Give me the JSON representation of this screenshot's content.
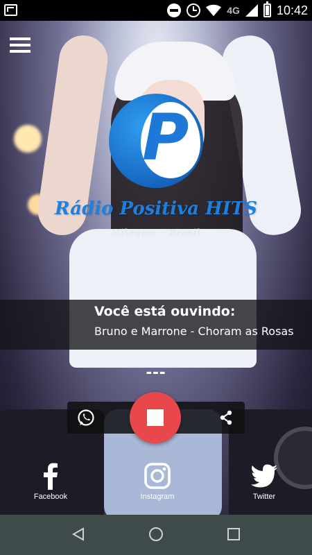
{
  "status_bar": {
    "network": "4G",
    "time": "10:42",
    "icons": [
      "gmail-icon",
      "do-not-disturb-icon",
      "alarm-icon",
      "wifi-icon",
      "signal-icon",
      "battery-icon"
    ]
  },
  "station": {
    "name": "Rádio Positiva HITS",
    "subtitle": "Milagres  -  Brasil",
    "logo_letter": "P",
    "brand_color": "#1e7fe0"
  },
  "now_playing": {
    "label": "Você está ouvindo:",
    "track": "Bruno e Marrone - Choram as Rosas"
  },
  "player": {
    "status_text": "---",
    "stop_color": "#e8474b"
  },
  "social": {
    "facebook": "Facebook",
    "instagram": "Instagram",
    "twitter": "Twitter"
  },
  "nav": {
    "icons": [
      "back-icon",
      "home-icon",
      "recents-icon"
    ]
  }
}
